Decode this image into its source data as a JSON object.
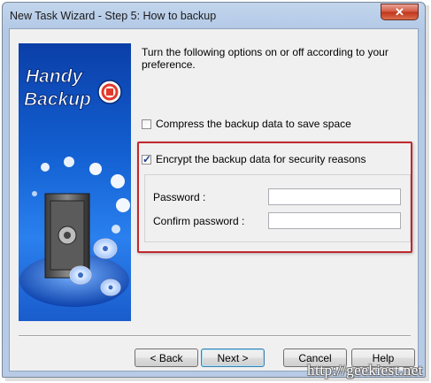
{
  "window": {
    "title": "New Task Wizard - Step 5: How to backup",
    "close_glyph": "✕"
  },
  "sidebar_art": {
    "logo_text_line1": "Handy",
    "logo_text_line2": "Backup",
    "accent_color": "#1360d2"
  },
  "main": {
    "intro_text": "Turn the following options on or off according to your preference.",
    "compress": {
      "label": "Compress the backup data to save space",
      "checked": false
    },
    "encrypt": {
      "label": "Encrypt the backup data for security reasons",
      "checked": true,
      "check_glyph": "✓"
    },
    "password": {
      "label": "Password :",
      "value": ""
    },
    "confirm_password": {
      "label": "Confirm password :",
      "value": ""
    },
    "highlight_color": "#c0282e"
  },
  "buttons": {
    "back": "< Back",
    "next": "Next >",
    "cancel": "Cancel",
    "help": "Help"
  },
  "watermark": "http://geekiest.net"
}
